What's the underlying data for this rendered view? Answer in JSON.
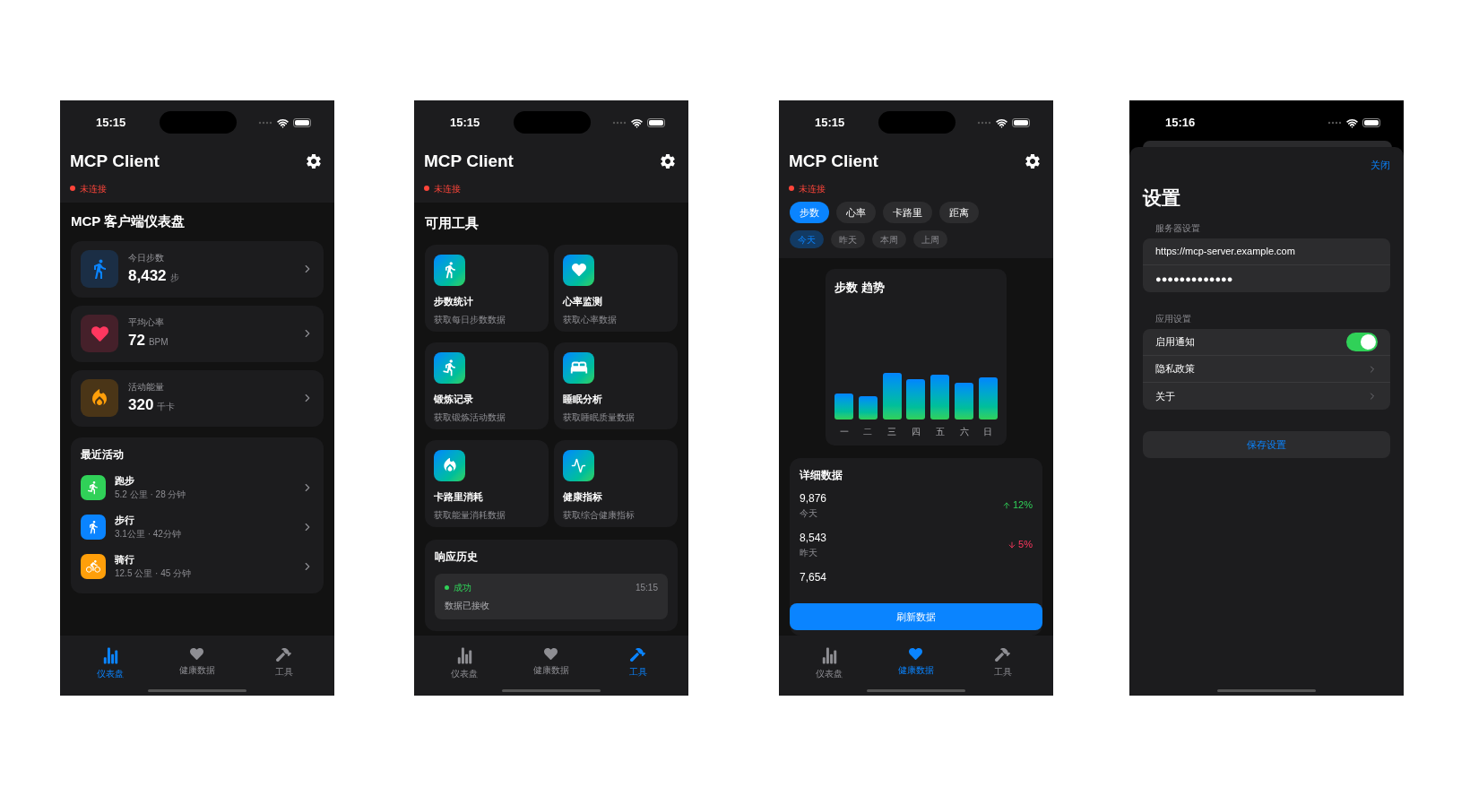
{
  "phones": [
    {
      "kind": "dashboard",
      "status_bar": {
        "time": "15:15"
      },
      "header": {
        "title": "MCP Client",
        "connection": "未连接",
        "connected": false
      },
      "section_title": "MCP 客户端仪表盘",
      "metrics": [
        {
          "kind": "steps",
          "label": "今日步数",
          "value": "8,432",
          "unit": "步"
        },
        {
          "kind": "heart",
          "label": "平均心率",
          "value": "72",
          "unit": "BPM"
        },
        {
          "kind": "energy",
          "label": "活动能量",
          "value": "320",
          "unit": "千卡"
        }
      ],
      "recent": {
        "title": "最近活动",
        "items": [
          {
            "kind": "run",
            "name": "跑步",
            "detail": "5.2 公里 · 28 分钟"
          },
          {
            "kind": "walk",
            "name": "步行",
            "detail": "3.1公里 · 42分钟"
          },
          {
            "kind": "bike",
            "name": "骑行",
            "detail": "12.5 公里 · 45 分钟"
          }
        ]
      },
      "tab_bar": [
        {
          "kind": "dashboard",
          "label": "仪表盘",
          "selected": true
        },
        {
          "kind": "health",
          "label": "健康数据",
          "selected": false
        },
        {
          "kind": "tools",
          "label": "工具",
          "selected": false
        }
      ]
    },
    {
      "kind": "tools",
      "status_bar": {
        "time": "15:15"
      },
      "header": {
        "title": "MCP Client",
        "connection": "未连接",
        "connected": false
      },
      "section_title": "可用工具",
      "tools": [
        {
          "kind": "walk",
          "name": "步数统计",
          "description": "获取每日步数数据"
        },
        {
          "kind": "heart",
          "name": "心率监测",
          "description": "获取心率数据"
        },
        {
          "kind": "run",
          "name": "锻炼记录",
          "description": "获取锻炼活动数据"
        },
        {
          "kind": "bed",
          "name": "睡眠分析",
          "description": "获取睡眠质量数据"
        },
        {
          "kind": "fire",
          "name": "卡路里消耗",
          "description": "获取能量消耗数据"
        },
        {
          "kind": "pulse",
          "name": "健康指标",
          "description": "获取综合健康指标"
        }
      ],
      "history": {
        "title": "响应历史",
        "items": [
          {
            "kind": "success",
            "status": "成功",
            "time": "15:15",
            "message": "数据已接收"
          }
        ]
      },
      "tab_bar": [
        {
          "kind": "dashboard",
          "label": "仪表盘",
          "selected": false
        },
        {
          "kind": "health",
          "label": "健康数据",
          "selected": false
        },
        {
          "kind": "tools",
          "label": "工具",
          "selected": true
        }
      ]
    },
    {
      "kind": "health",
      "status_bar": {
        "time": "15:15"
      },
      "header": {
        "title": "MCP Client",
        "connection": "未连接",
        "connected": false
      },
      "metric_tabs": [
        {
          "label": "步数",
          "selected": true
        },
        {
          "label": "心率",
          "selected": false
        },
        {
          "label": "卡路里",
          "selected": false
        },
        {
          "label": "距离",
          "selected": false
        }
      ],
      "period_tabs": [
        {
          "label": "今天",
          "selected": true
        },
        {
          "label": "昨天",
          "selected": false
        },
        {
          "label": "本周",
          "selected": false
        },
        {
          "label": "上周",
          "selected": false
        }
      ],
      "chart": {
        "title": "步数 趋势",
        "day_labels": [
          "一",
          "二",
          "三",
          "四",
          "五",
          "六",
          "日"
        ]
      },
      "details": {
        "title": "详细数据",
        "rows": [
          {
            "value": "9,876",
            "label": "今天",
            "change": "12%",
            "kind": "increase"
          },
          {
            "value": "8,543",
            "label": "昨天",
            "change": "5%",
            "kind": "decrease"
          },
          {
            "value": "7,654"
          }
        ]
      },
      "refresh_button": "刷新数据",
      "tab_bar": [
        {
          "kind": "dashboard",
          "label": "仪表盘",
          "selected": false
        },
        {
          "kind": "health",
          "label": "健康数据",
          "selected": true
        },
        {
          "kind": "tools",
          "label": "工具",
          "selected": false
        }
      ]
    },
    {
      "kind": "settings",
      "status_bar": {
        "time": "15:16"
      },
      "close_button": "关闭",
      "title": "设置",
      "sections": [
        {
          "header": "服务器设置",
          "rows": [
            {
              "kind": "text_field",
              "value": "https://mcp-server.example.com"
            },
            {
              "kind": "text_field",
              "value": "●●●●●●●●●●●●●"
            }
          ]
        },
        {
          "header": "应用设置",
          "rows": [
            {
              "kind": "toggle",
              "label": "启用通知",
              "on": true
            },
            {
              "kind": "link",
              "label": "隐私政策"
            },
            {
              "kind": "link",
              "label": "关于"
            }
          ]
        }
      ],
      "save_button": "保存设置"
    }
  ]
}
